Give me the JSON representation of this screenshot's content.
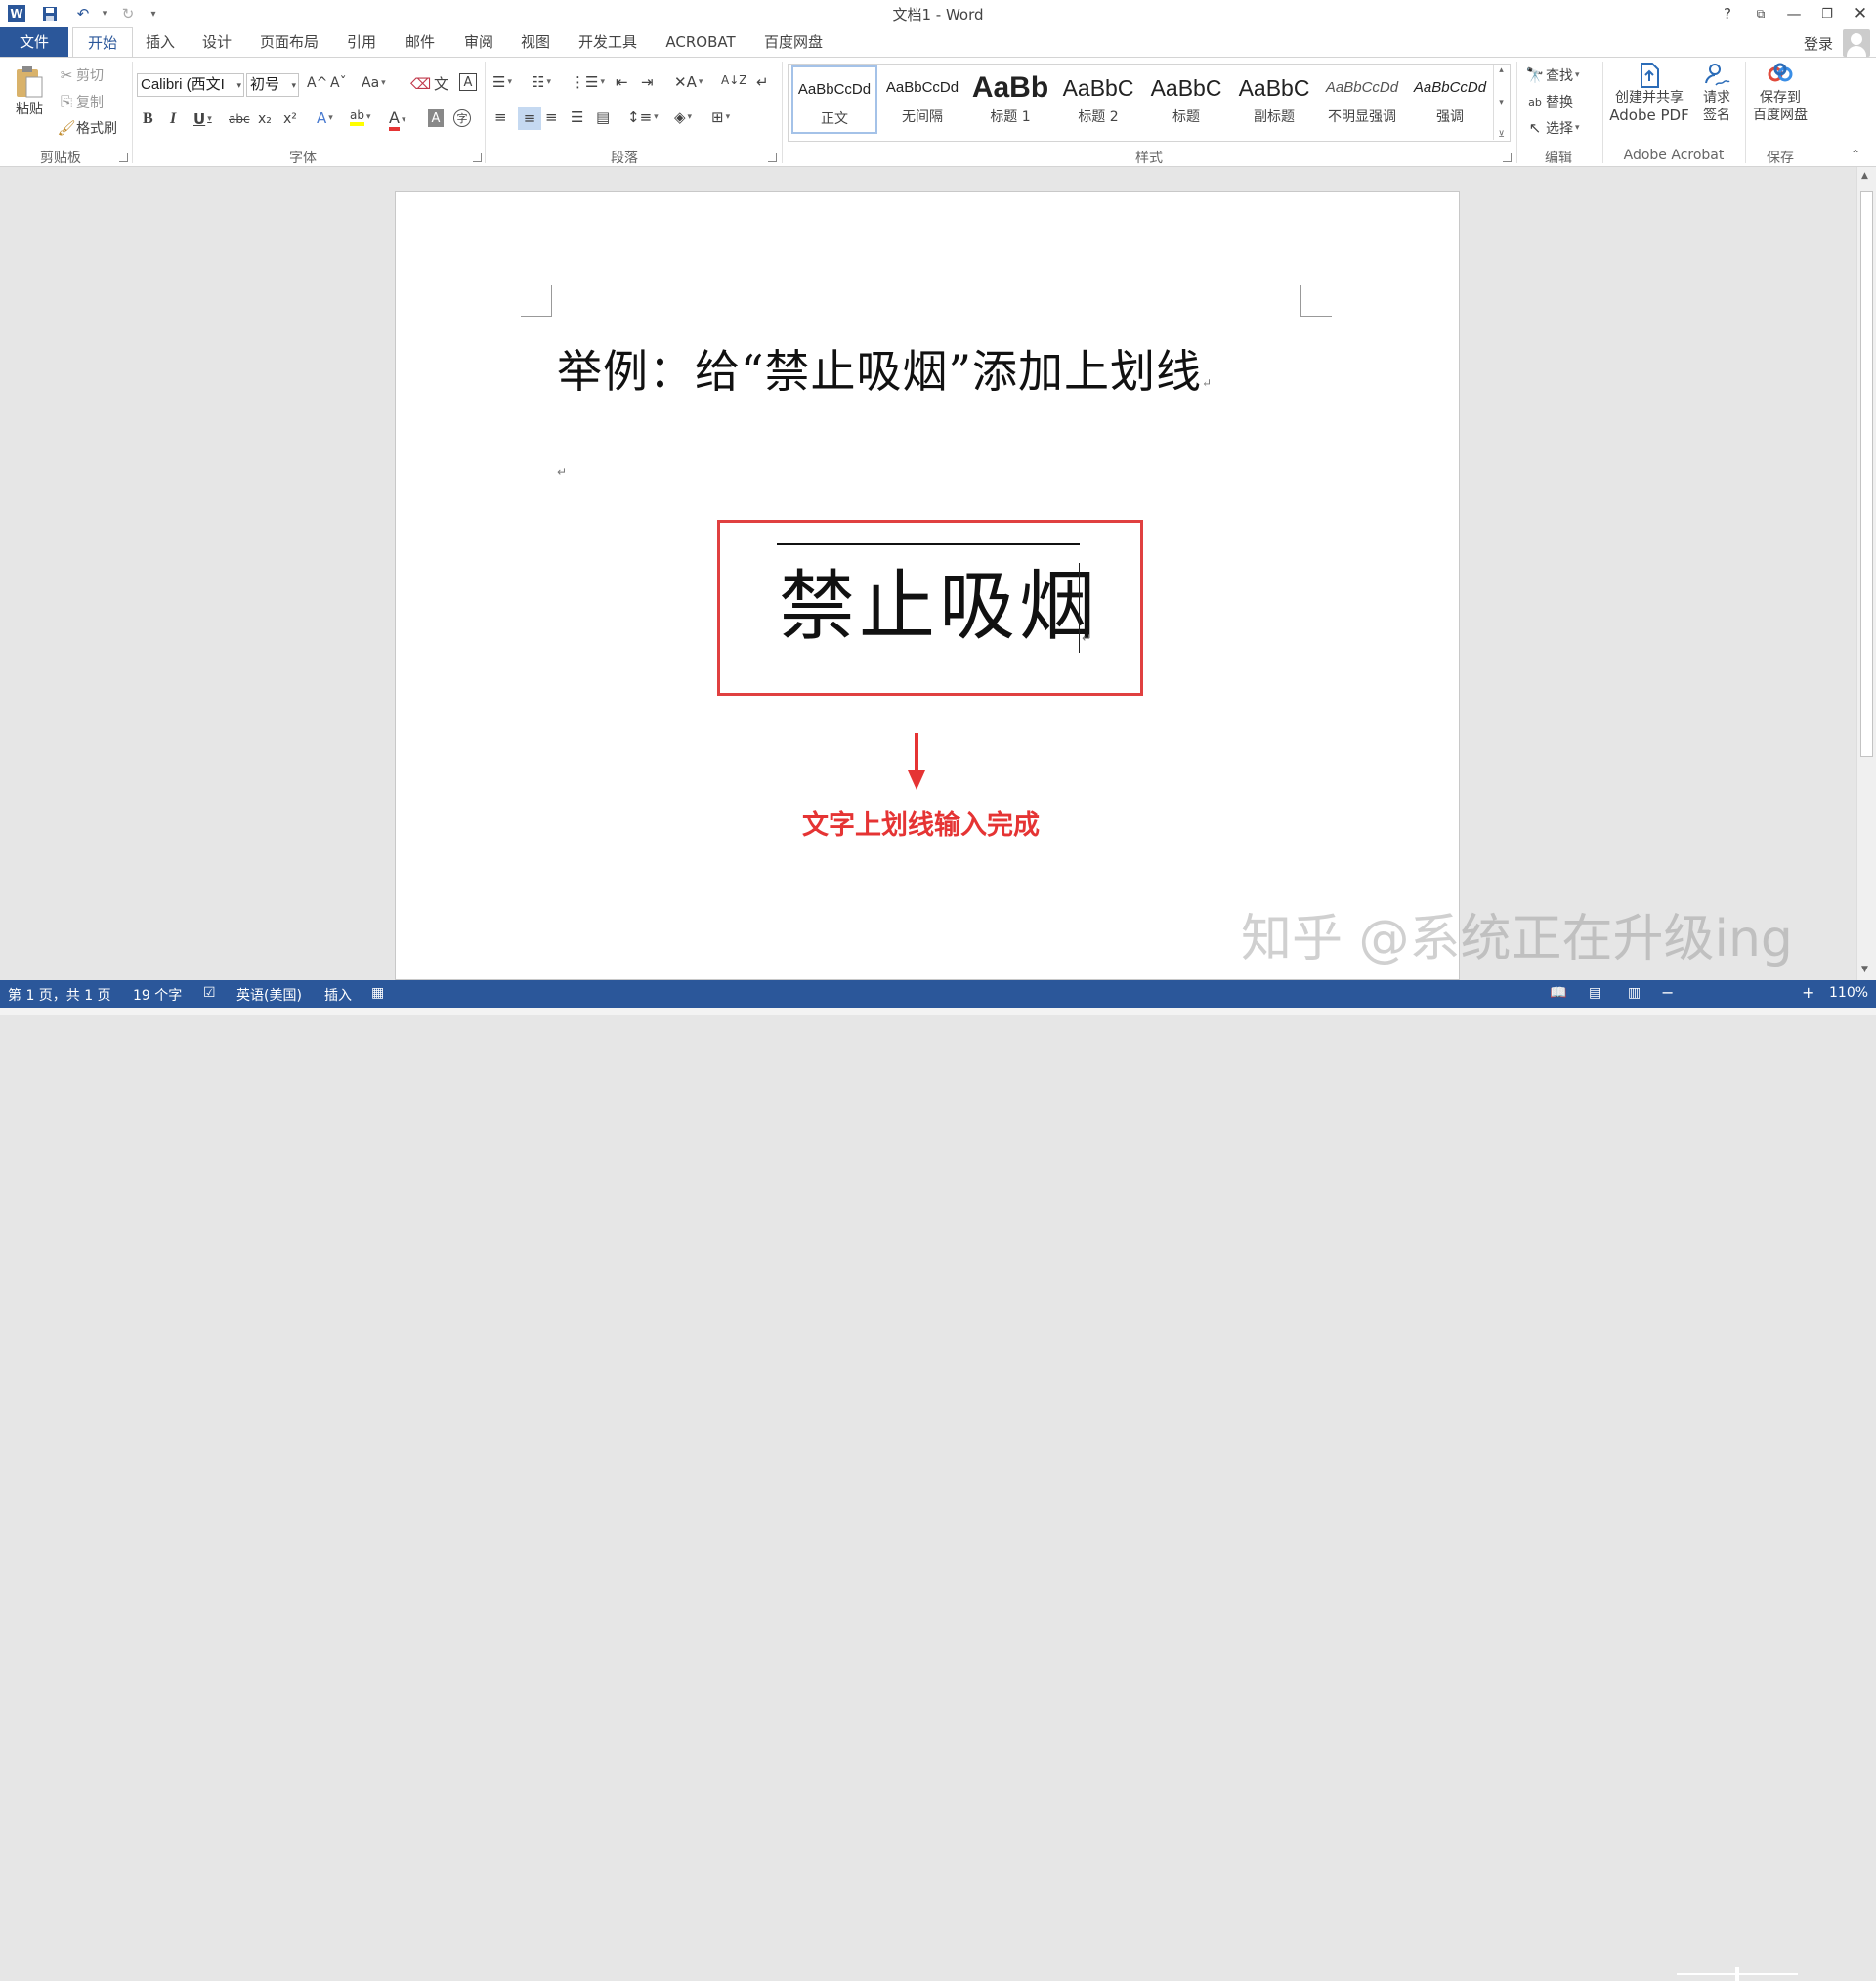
{
  "window": {
    "title": "文档1 - Word",
    "help": "?",
    "signin": "登录"
  },
  "tabs": [
    "开始",
    "插入",
    "设计",
    "页面布局",
    "引用",
    "邮件",
    "审阅",
    "视图",
    "开发工具",
    "ACROBAT",
    "百度网盘"
  ],
  "file_tab": "文件",
  "clipboard": {
    "paste": "粘贴",
    "cut": "剪切",
    "copy": "复制",
    "format_painter": "格式刷",
    "label": "剪贴板"
  },
  "font": {
    "name": "Calibri (西文I",
    "size": "初号",
    "label": "字体",
    "grow": "A^",
    "shrink": "Aˇ",
    "case": "Aa",
    "bold": "B",
    "italic": "I",
    "underline": "U",
    "strike": "abc",
    "subscript": "x₂",
    "superscript": "x²",
    "font_color_accent": "#e53434",
    "highlight_accent": "#ffff00"
  },
  "paragraph": {
    "label": "段落"
  },
  "styles": {
    "label": "样式",
    "items": [
      {
        "sample": "AaBbCcDd",
        "name": "正文",
        "selected": true
      },
      {
        "sample": "AaBbCcDd",
        "name": "无间隔",
        "selected": false
      },
      {
        "sample": "AaBb",
        "name": "标题 1",
        "selected": false
      },
      {
        "sample": "AaBbC",
        "name": "标题 2",
        "selected": false
      },
      {
        "sample": "AaBbC",
        "name": "标题",
        "selected": false
      },
      {
        "sample": "AaBbC",
        "name": "副标题",
        "selected": false
      },
      {
        "sample": "AaBbCcDd",
        "name": "不明显强调",
        "selected": false
      },
      {
        "sample": "AaBbCcDd",
        "name": "强调",
        "selected": false
      }
    ]
  },
  "editing": {
    "find": "查找",
    "replace": "替换",
    "select": "选择",
    "label": "编辑"
  },
  "acrobat": {
    "create_share_1": "创建并共享",
    "create_share_2": "Adobe PDF",
    "request_1": "请求",
    "request_2": "签名",
    "label": "Adobe Acrobat"
  },
  "save_group": {
    "save_1": "保存到",
    "save_2": "百度网盘",
    "label": "保存"
  },
  "document": {
    "heading": "举例：给“禁止吸烟”添加上划线",
    "overlined_text": "禁止吸烟",
    "annotation": "文字上划线输入完成",
    "annotation_color": "#e53434"
  },
  "watermark": "知乎 @系统正在升级ing",
  "status": {
    "page": "第 1 页，共 1 页",
    "words": "19 个字",
    "language": "英语(美国)",
    "mode": "插入",
    "zoom": "110%",
    "zoom_minus": "−",
    "zoom_plus": "+"
  }
}
